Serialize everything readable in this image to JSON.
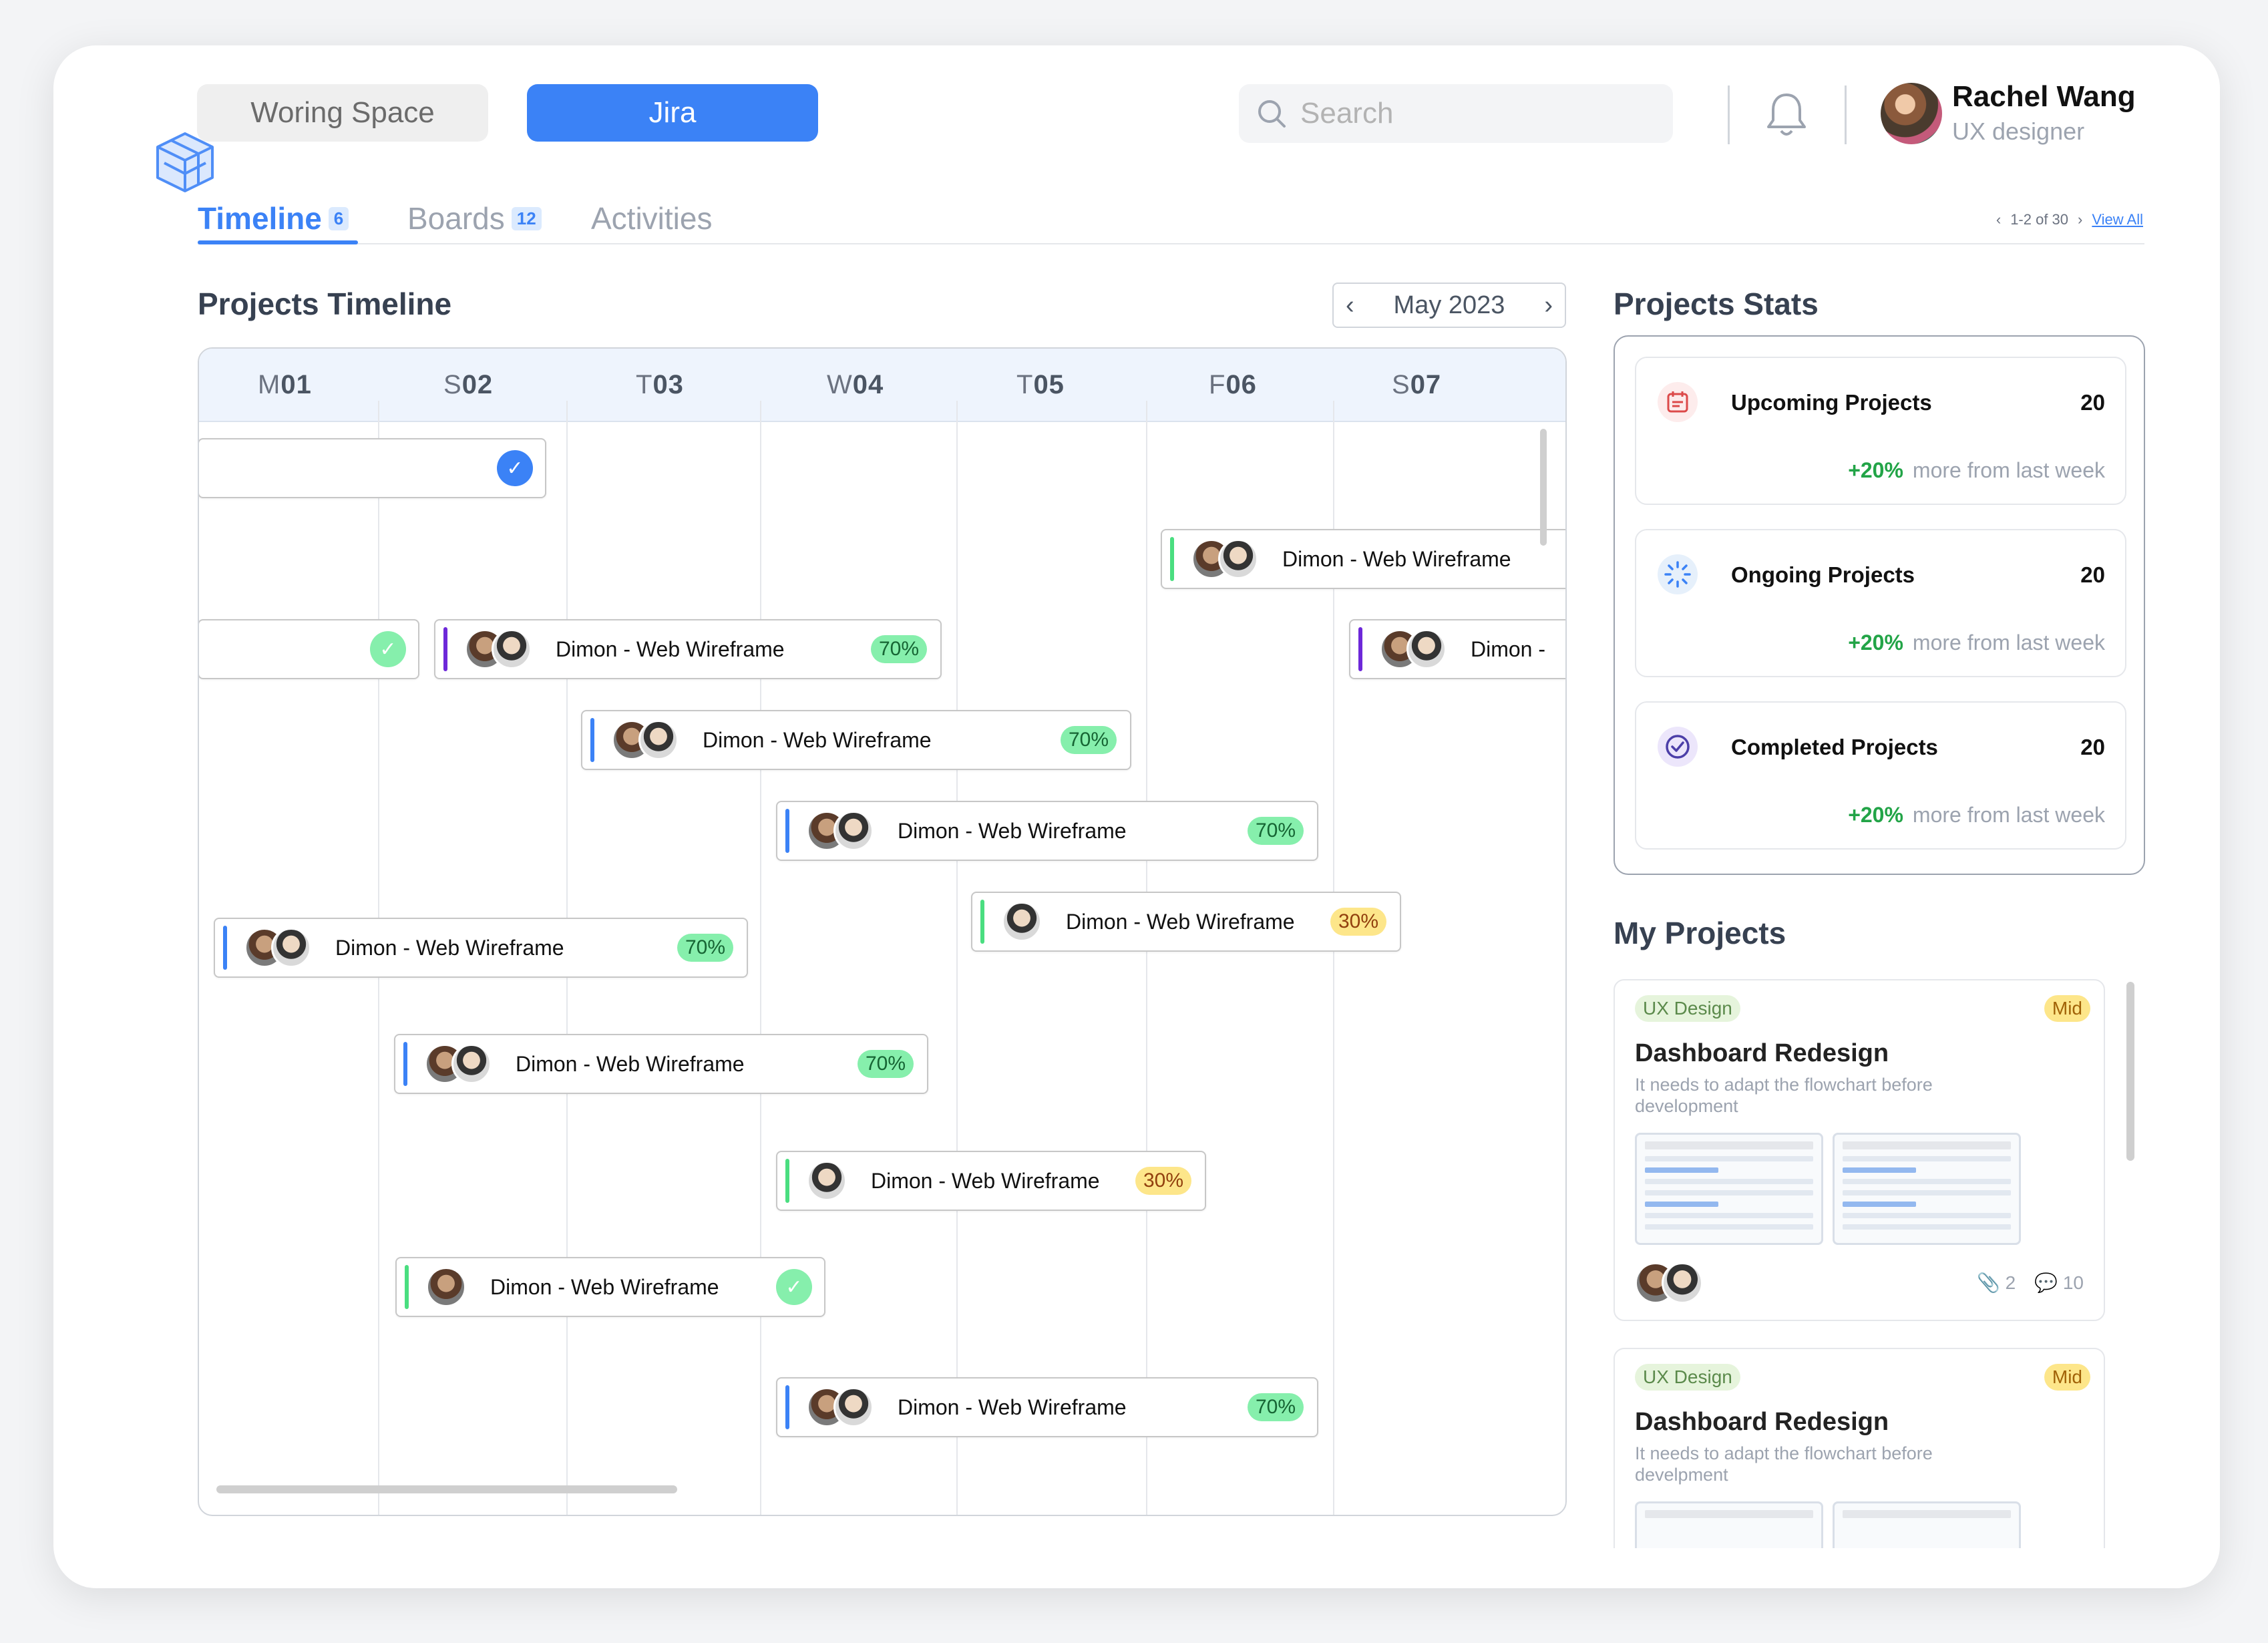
{
  "header": {
    "workspace_label": "Woring Space",
    "jira_label": "Jira",
    "search_placeholder": "Search",
    "user_name": "Rachel Wang",
    "user_role": "UX designer"
  },
  "tabs": [
    {
      "label": "Timeline",
      "badge": "6"
    },
    {
      "label": "Boards",
      "badge": "12"
    },
    {
      "label": "Activities"
    }
  ],
  "pager": {
    "range": "1-2 of 30",
    "view_all": "View All"
  },
  "timeline": {
    "title": "Projects Timeline",
    "month": "May  2023",
    "days": [
      {
        "letter": "M",
        "num": "01"
      },
      {
        "letter": "S",
        "num": "02"
      },
      {
        "letter": "T",
        "num": "03"
      },
      {
        "letter": "W",
        "num": "04"
      },
      {
        "letter": "T",
        "num": "05"
      },
      {
        "letter": "F",
        "num": "06"
      },
      {
        "letter": "S",
        "num": "07"
      }
    ],
    "bar_label": "Dimon - Web Wireframe",
    "bar_label_truncated": "Dimon -",
    "pct_70": "70%",
    "pct_30": "30%"
  },
  "stats": {
    "title": "Projects Stats",
    "items": [
      {
        "name": "Upcoming Projects",
        "count": "20",
        "delta": "+20%",
        "note": "more from last week"
      },
      {
        "name": "Ongoing Projects",
        "count": "20",
        "delta": "+20%",
        "note": "more from last week"
      },
      {
        "name": "Completed Projects",
        "count": "20",
        "delta": "+20%",
        "note": "more from last week"
      }
    ]
  },
  "my_projects": {
    "title": "My Projects",
    "cards": [
      {
        "category": "UX Design",
        "level": "Mid",
        "title": "Dashboard Redesign",
        "desc": "It needs to adapt the flowchart before development",
        "attachments": "2",
        "comments": "10"
      },
      {
        "category": "UX Design",
        "level": "Mid",
        "title": "Dashboard Redesign",
        "desc": "It needs to adapt the flowchart before develpment"
      }
    ]
  },
  "colors": {
    "accent": "#3b82f6",
    "success": "#22a447",
    "bar_green": "#4ade80",
    "bar_purple": "#6d28d9",
    "bar_blue": "#3b82f6"
  }
}
